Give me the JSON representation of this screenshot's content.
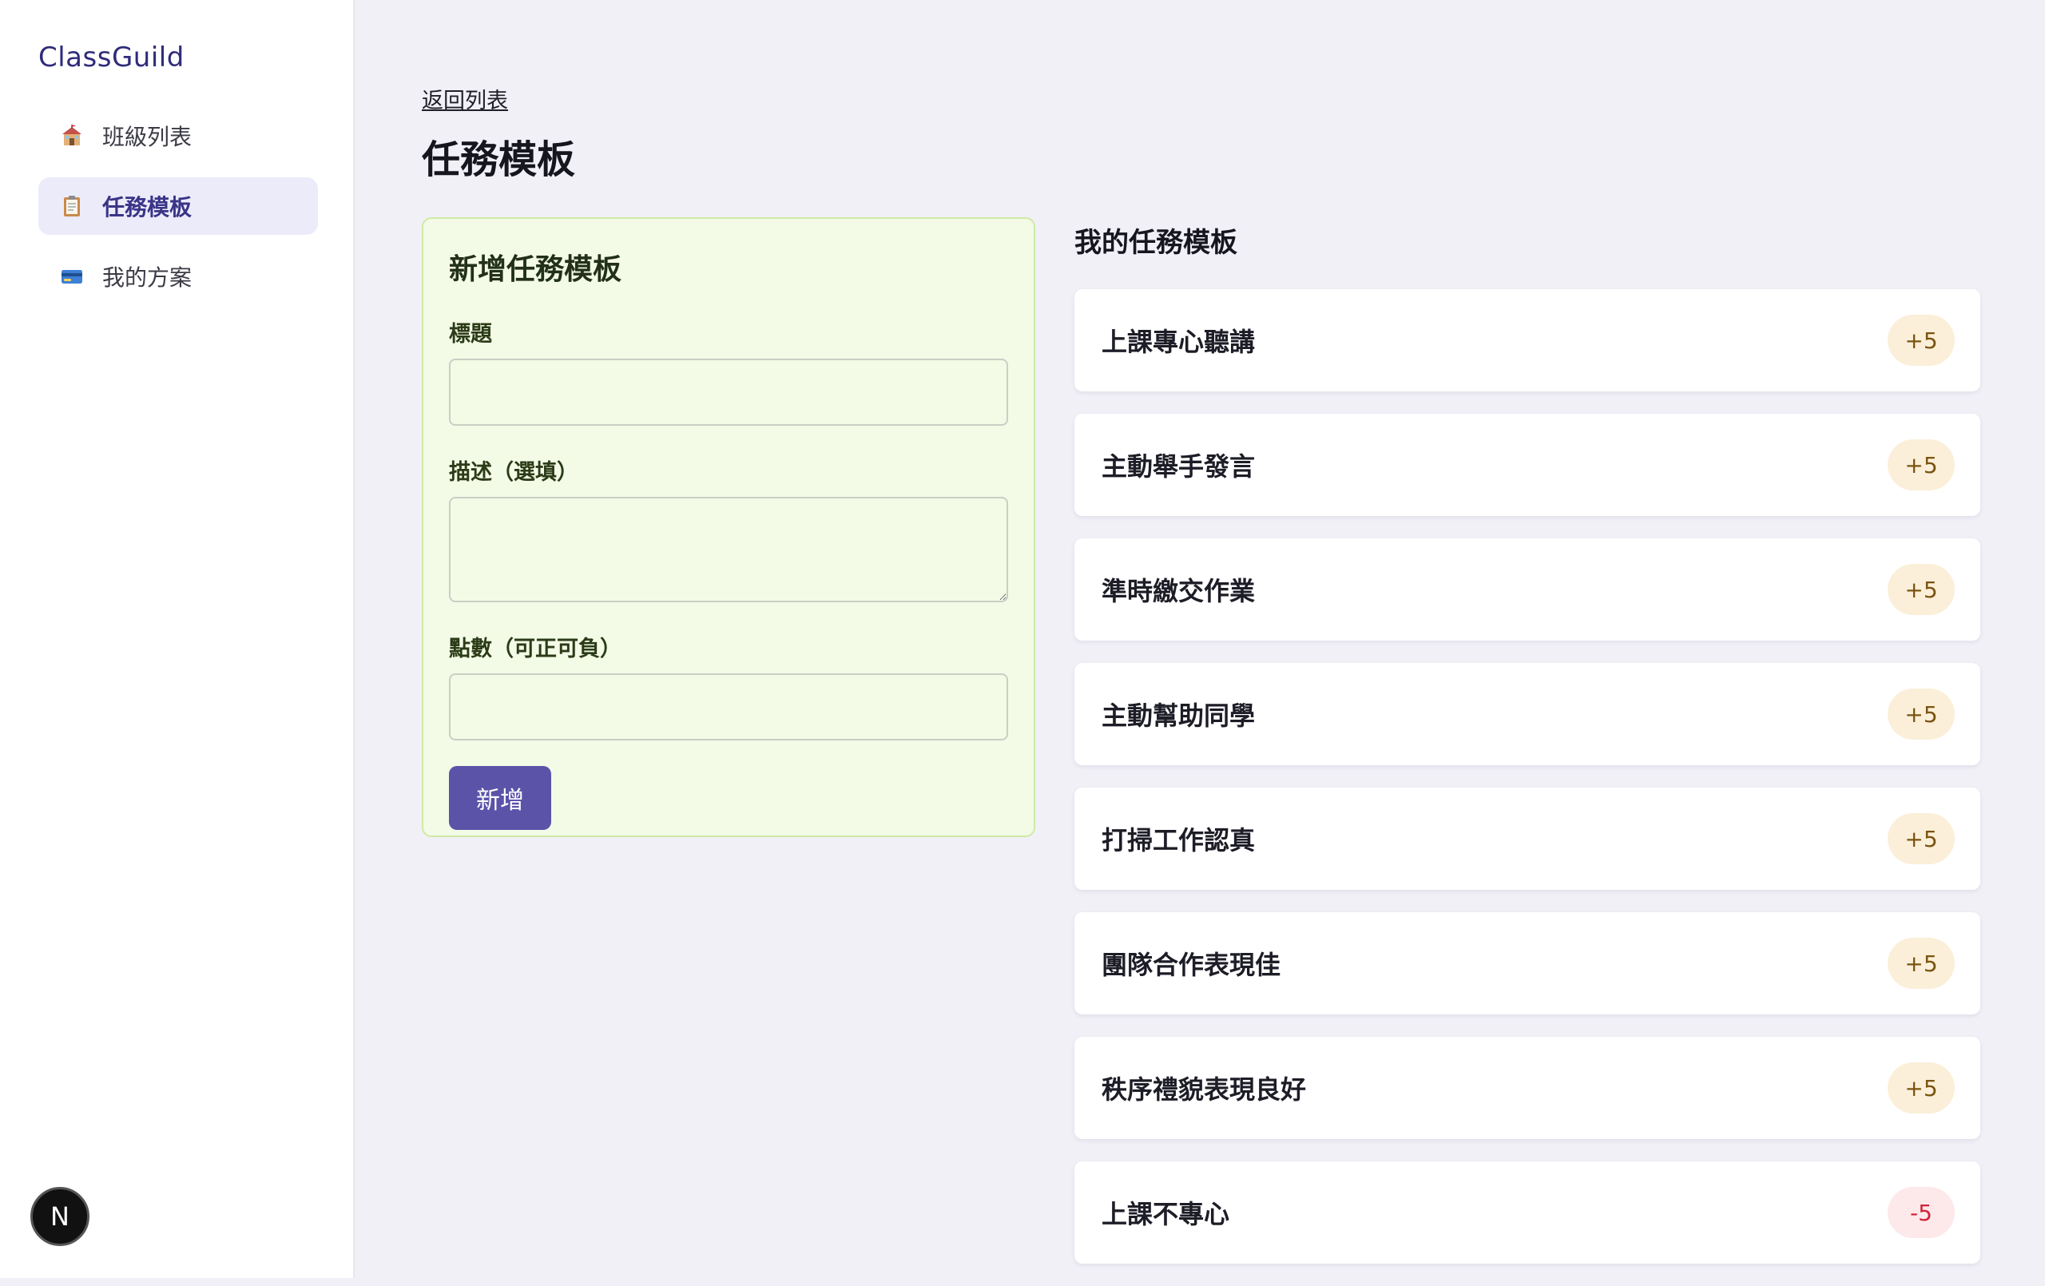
{
  "app": {
    "brand": "ClassGuild"
  },
  "sidebar": {
    "items": [
      {
        "label": "班級列表",
        "icon": "school-icon",
        "active": false
      },
      {
        "label": "任務模板",
        "icon": "clipboard-icon",
        "active": true
      },
      {
        "label": "我的方案",
        "icon": "credit-card-icon",
        "active": false
      }
    ]
  },
  "badge": {
    "letter": "N",
    "icon": "nextjs-icon"
  },
  "header": {
    "back_label": "返回列表",
    "title": "任務模板"
  },
  "form": {
    "title": "新增任務模板",
    "title_label": "標題",
    "title_value": "",
    "description_label": "描述（選填）",
    "description_value": "",
    "points_label": "點數（可正可負）",
    "points_value": "",
    "submit_label": "新增"
  },
  "templates": {
    "heading": "我的任務模板",
    "items": [
      {
        "name": "上課專心聽講",
        "points": "+5"
      },
      {
        "name": "主動舉手發言",
        "points": "+5"
      },
      {
        "name": "準時繳交作業",
        "points": "+5"
      },
      {
        "name": "主動幫助同學",
        "points": "+5"
      },
      {
        "name": "打掃工作認真",
        "points": "+5"
      },
      {
        "name": "團隊合作表現佳",
        "points": "+5"
      },
      {
        "name": "秩序禮貌表現良好",
        "points": "+5"
      },
      {
        "name": "上課不專心",
        "points": "-5"
      }
    ]
  },
  "colors": {
    "accent": "#5b53a8",
    "brand": "#2f2c7a",
    "form_bg": "#f3fae6",
    "positive_badge_bg": "#fbefd9",
    "negative_badge_text": "#d0253a"
  }
}
